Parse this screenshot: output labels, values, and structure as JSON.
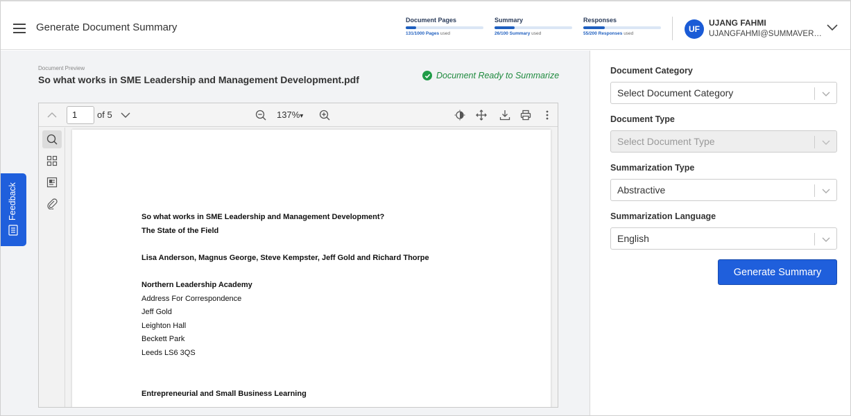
{
  "header": {
    "title": "Generate Document Summary",
    "usage": [
      {
        "title": "Document Pages",
        "used_text": "131/1000 Pages",
        "suffix": "used",
        "fraction": 0.131
      },
      {
        "title": "Summary",
        "used_text": "26/100 Summary",
        "suffix": "used",
        "fraction": 0.26
      },
      {
        "title": "Responses",
        "used_text": "55/200 Responses",
        "suffix": "used",
        "fraction": 0.275
      }
    ],
    "user": {
      "initials": "UF",
      "name": "UJANG FAHMI",
      "email": "UJANGFAHMI@SUMMAVERSE.COM"
    }
  },
  "preview": {
    "label": "Document Preview",
    "file_name": "So what works in SME Leadership and Management Development.pdf",
    "status": "Document Ready to Summarize"
  },
  "viewer": {
    "page_number": "1",
    "page_of": "of 5",
    "zoom": "137%",
    "zoom_arrow": "▾",
    "page_lines": [
      {
        "text": "So what works in SME Leadership and Management Development?",
        "bold": true
      },
      {
        "text": "The State of the Field",
        "bold": true
      },
      {
        "text": "Lisa Anderson, Magnus George, Steve Kempster, Jeff Gold and Richard Thorpe",
        "bold": true
      },
      {
        "text": "Northern Leadership Academy",
        "bold": true
      },
      {
        "text": "Address For Correspondence",
        "bold": false
      },
      {
        "text": "Jeff Gold",
        "bold": false
      },
      {
        "text": "Leighton Hall",
        "bold": false
      },
      {
        "text": "Beckett Park",
        "bold": false
      },
      {
        "text": "Leeds LS6 3QS",
        "bold": false
      },
      {
        "text": "Entrepreneurial and Small Business Learning",
        "bold": true
      }
    ]
  },
  "form": {
    "category": {
      "label": "Document Category",
      "value": "Select Document Category"
    },
    "type": {
      "label": "Document Type",
      "value": "Select Document Type"
    },
    "summarization_type": {
      "label": "Summarization Type",
      "value": "Abstractive"
    },
    "language": {
      "label": "Summarization Language",
      "value": "English"
    },
    "button": "Generate Summary"
  },
  "feedback": {
    "label": "Feedback"
  },
  "colors": {
    "accent": "#1f5fdc",
    "success": "#1f8a3e"
  }
}
